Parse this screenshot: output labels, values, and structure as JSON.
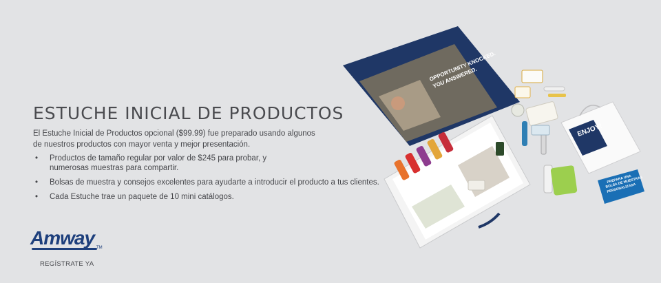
{
  "banner": {
    "title": "ESTUCHE INICIAL DE PRODUCTOS",
    "intro": "El Estuche Inicial de Productos opcional ($99.99) fue preparado usando algunos de nuestros productos con mayor venta y mejor presentación.",
    "bullets": [
      "Productos de tamaño regular por valor de $245 para probar, y numerosas muestras para compartir.",
      "Bolsas de muestra y consejos excelentes para ayudarte a introducir el producto a tus clientes.",
      "Cada Estuche trae un paquete de 10 mini catálogos."
    ]
  },
  "brand": {
    "logo_text": "Amway",
    "tm": "TM"
  },
  "cta": {
    "label": "REGÍSTRATE YA"
  },
  "kit_image": {
    "poster_line1": "OPPORTUNITY KNOCKED.",
    "poster_line2": "YOU ANSWERED.",
    "bag_text": "ENJOY!",
    "card_line1": "PREPARA UNA",
    "card_line2": "BOLSA DE MUESTRAS",
    "card_line3": "PERSONALIZADA"
  },
  "colors": {
    "background": "#e2e3e5",
    "text": "#45464a",
    "brand_blue": "#1d3f7c",
    "box_navy": "#1f3766",
    "card_blue": "#1a6fb5"
  }
}
